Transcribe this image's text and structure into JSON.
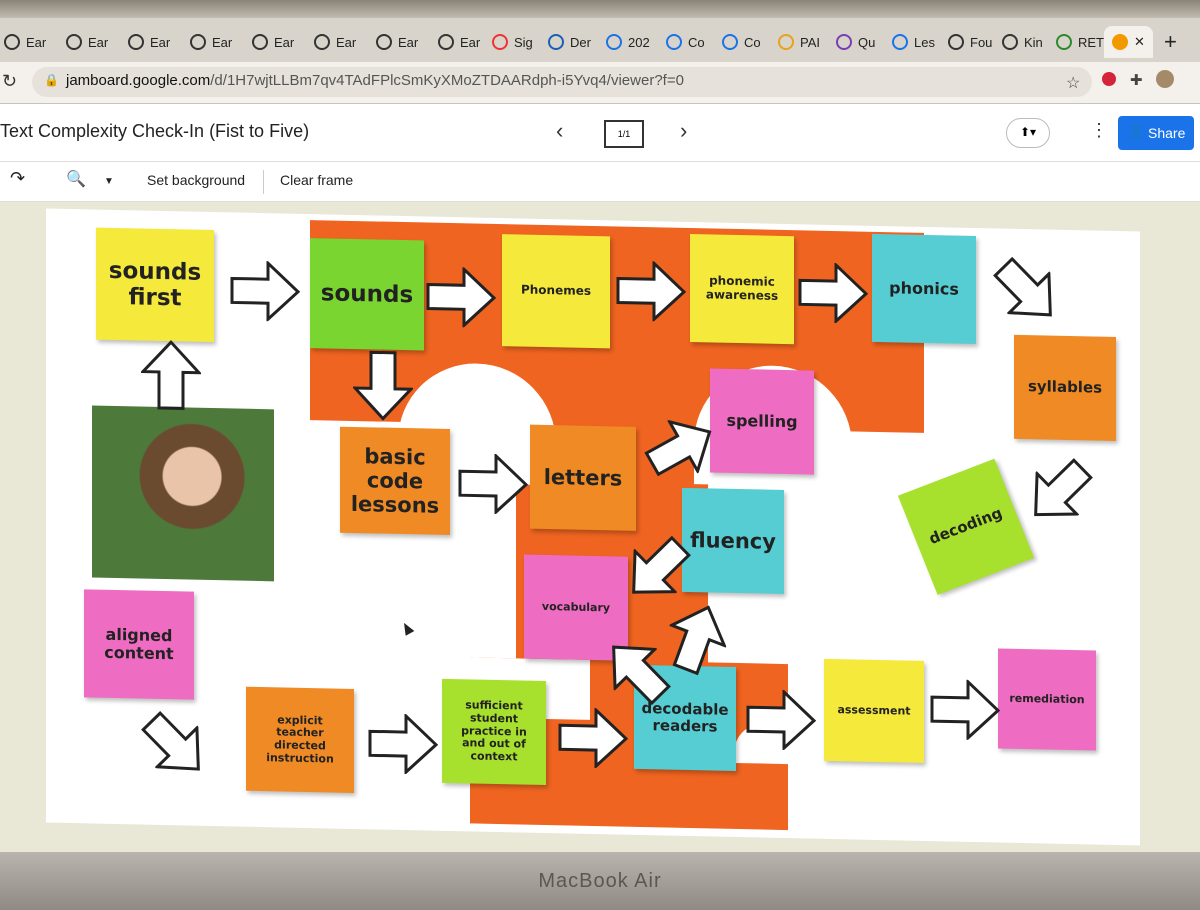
{
  "browser": {
    "tabs": [
      {
        "label": "Ear"
      },
      {
        "label": "Ear"
      },
      {
        "label": "Ear"
      },
      {
        "label": "Ear"
      },
      {
        "label": "Ear"
      },
      {
        "label": "Ear"
      },
      {
        "label": "Ear"
      },
      {
        "label": "Ear"
      },
      {
        "label": "Sig"
      },
      {
        "label": "Der"
      },
      {
        "label": "202"
      },
      {
        "label": "Co"
      },
      {
        "label": "Co"
      },
      {
        "label": "PAI"
      },
      {
        "label": "Qu"
      },
      {
        "label": "Les"
      },
      {
        "label": "Fou"
      },
      {
        "label": "Kin"
      },
      {
        "label": "RET"
      }
    ],
    "url_host": "jamboard.google.com",
    "url_path": "/d/1H7wjtLLBm7qv4TAdFPlcSmKyXMoZTDAARdph-i5Yvq4/viewer?f=0",
    "icons": [
      "refresh-icon",
      "lock-icon",
      "star-icon",
      "extension-icon"
    ]
  },
  "app": {
    "title": "Text Complexity Check-In (Fist to Five)",
    "frame_indicator": "1/1",
    "share_label": "Share"
  },
  "toolbar": {
    "set_background": "Set background",
    "clear_frame": "Clear frame"
  },
  "notes": {
    "sounds_first": "sounds first",
    "sounds": "sounds",
    "phonemes": "Phonemes",
    "phonemic_awareness": "phonemic awareness",
    "phonics": "phonics",
    "syllables": "syllables",
    "spelling": "spelling",
    "basic_code": "basic code lessons",
    "letters": "letters",
    "fluency": "fluency",
    "decoding": "decoding",
    "vocabulary": "vocabulary",
    "aligned_content": "aligned content",
    "explicit": "explicit teacher directed instruction",
    "sufficient": "sufficient student practice in and out of context",
    "decodable": "decodable readers",
    "assessment": "assessment",
    "remediation": "remediation"
  },
  "device": {
    "brand": "MacBook Air"
  }
}
